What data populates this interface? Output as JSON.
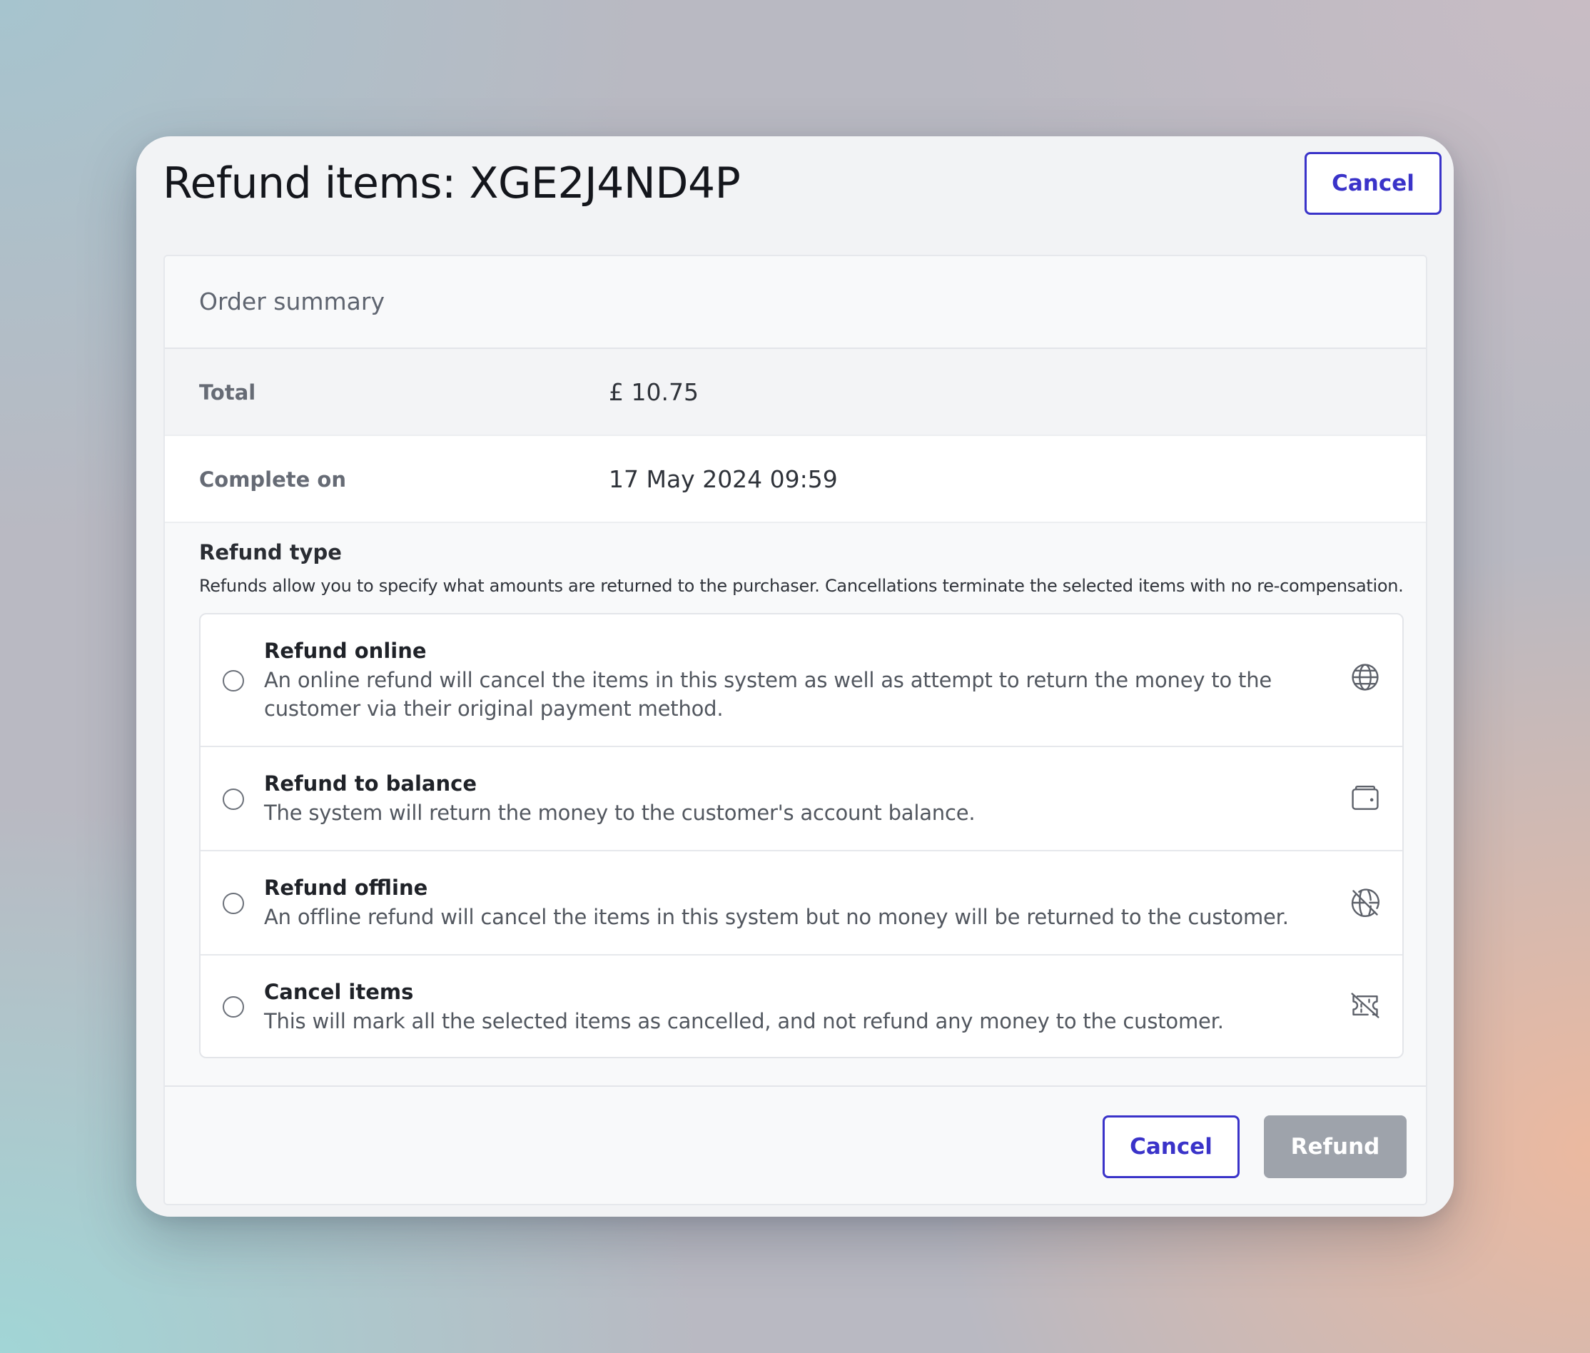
{
  "modal": {
    "title": "Refund items: XGE2J4ND4P",
    "top_cancel_label": "Cancel"
  },
  "order_summary": {
    "header": "Order summary",
    "rows": [
      {
        "label": "Total",
        "value": "£ 10.75"
      },
      {
        "label": "Complete on",
        "value": "17 May 2024 09:59"
      }
    ]
  },
  "refund_type": {
    "title": "Refund type",
    "description": "Refunds allow you to specify what amounts are returned to the purchaser. Cancellations terminate the selected items with no re-compensation.",
    "options": [
      {
        "title": "Refund online",
        "description": "An online refund will cancel the items in this system as well as attempt to return the money to the customer via their original payment method.",
        "icon": "globe-icon",
        "selected": false
      },
      {
        "title": "Refund to balance",
        "description": "The system will return the money to the customer's account balance.",
        "icon": "wallet-icon",
        "selected": false
      },
      {
        "title": "Refund offline",
        "description": "An offline refund will cancel the items in this system but no money will be returned to the customer.",
        "icon": "globe-off-icon",
        "selected": false
      },
      {
        "title": "Cancel items",
        "description": "This will mark all the selected items as cancelled, and not refund any money to the customer.",
        "icon": "ticket-off-icon",
        "selected": false
      }
    ]
  },
  "footer": {
    "cancel_label": "Cancel",
    "refund_label": "Refund",
    "refund_disabled": true
  },
  "colors": {
    "accent": "#3a33c9",
    "disabled_button": "#9ea3ab"
  }
}
